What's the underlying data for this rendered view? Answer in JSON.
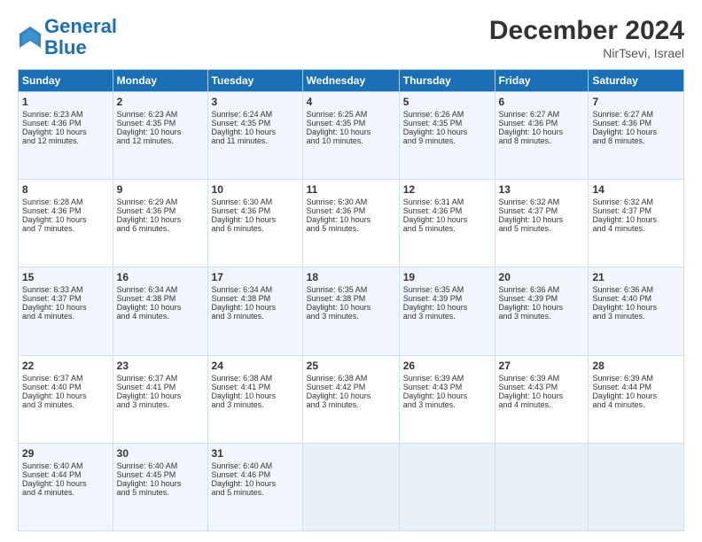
{
  "header": {
    "logo_line1": "General",
    "logo_line2": "Blue",
    "month_title": "December 2024",
    "location": "NirTsevi, Israel"
  },
  "weekdays": [
    "Sunday",
    "Monday",
    "Tuesday",
    "Wednesday",
    "Thursday",
    "Friday",
    "Saturday"
  ],
  "weeks": [
    [
      {
        "num": "1",
        "lines": [
          "Sunrise: 6:23 AM",
          "Sunset: 4:36 PM",
          "Daylight: 10 hours",
          "and 12 minutes."
        ]
      },
      {
        "num": "2",
        "lines": [
          "Sunrise: 6:23 AM",
          "Sunset: 4:35 PM",
          "Daylight: 10 hours",
          "and 12 minutes."
        ]
      },
      {
        "num": "3",
        "lines": [
          "Sunrise: 6:24 AM",
          "Sunset: 4:35 PM",
          "Daylight: 10 hours",
          "and 11 minutes."
        ]
      },
      {
        "num": "4",
        "lines": [
          "Sunrise: 6:25 AM",
          "Sunset: 4:35 PM",
          "Daylight: 10 hours",
          "and 10 minutes."
        ]
      },
      {
        "num": "5",
        "lines": [
          "Sunrise: 6:26 AM",
          "Sunset: 4:35 PM",
          "Daylight: 10 hours",
          "and 9 minutes."
        ]
      },
      {
        "num": "6",
        "lines": [
          "Sunrise: 6:27 AM",
          "Sunset: 4:36 PM",
          "Daylight: 10 hours",
          "and 8 minutes."
        ]
      },
      {
        "num": "7",
        "lines": [
          "Sunrise: 6:27 AM",
          "Sunset: 4:36 PM",
          "Daylight: 10 hours",
          "and 8 minutes."
        ]
      }
    ],
    [
      {
        "num": "8",
        "lines": [
          "Sunrise: 6:28 AM",
          "Sunset: 4:36 PM",
          "Daylight: 10 hours",
          "and 7 minutes."
        ]
      },
      {
        "num": "9",
        "lines": [
          "Sunrise: 6:29 AM",
          "Sunset: 4:36 PM",
          "Daylight: 10 hours",
          "and 6 minutes."
        ]
      },
      {
        "num": "10",
        "lines": [
          "Sunrise: 6:30 AM",
          "Sunset: 4:36 PM",
          "Daylight: 10 hours",
          "and 6 minutes."
        ]
      },
      {
        "num": "11",
        "lines": [
          "Sunrise: 6:30 AM",
          "Sunset: 4:36 PM",
          "Daylight: 10 hours",
          "and 5 minutes."
        ]
      },
      {
        "num": "12",
        "lines": [
          "Sunrise: 6:31 AM",
          "Sunset: 4:36 PM",
          "Daylight: 10 hours",
          "and 5 minutes."
        ]
      },
      {
        "num": "13",
        "lines": [
          "Sunrise: 6:32 AM",
          "Sunset: 4:37 PM",
          "Daylight: 10 hours",
          "and 5 minutes."
        ]
      },
      {
        "num": "14",
        "lines": [
          "Sunrise: 6:32 AM",
          "Sunset: 4:37 PM",
          "Daylight: 10 hours",
          "and 4 minutes."
        ]
      }
    ],
    [
      {
        "num": "15",
        "lines": [
          "Sunrise: 6:33 AM",
          "Sunset: 4:37 PM",
          "Daylight: 10 hours",
          "and 4 minutes."
        ]
      },
      {
        "num": "16",
        "lines": [
          "Sunrise: 6:34 AM",
          "Sunset: 4:38 PM",
          "Daylight: 10 hours",
          "and 4 minutes."
        ]
      },
      {
        "num": "17",
        "lines": [
          "Sunrise: 6:34 AM",
          "Sunset: 4:38 PM",
          "Daylight: 10 hours",
          "and 3 minutes."
        ]
      },
      {
        "num": "18",
        "lines": [
          "Sunrise: 6:35 AM",
          "Sunset: 4:38 PM",
          "Daylight: 10 hours",
          "and 3 minutes."
        ]
      },
      {
        "num": "19",
        "lines": [
          "Sunrise: 6:35 AM",
          "Sunset: 4:39 PM",
          "Daylight: 10 hours",
          "and 3 minutes."
        ]
      },
      {
        "num": "20",
        "lines": [
          "Sunrise: 6:36 AM",
          "Sunset: 4:39 PM",
          "Daylight: 10 hours",
          "and 3 minutes."
        ]
      },
      {
        "num": "21",
        "lines": [
          "Sunrise: 6:36 AM",
          "Sunset: 4:40 PM",
          "Daylight: 10 hours",
          "and 3 minutes."
        ]
      }
    ],
    [
      {
        "num": "22",
        "lines": [
          "Sunrise: 6:37 AM",
          "Sunset: 4:40 PM",
          "Daylight: 10 hours",
          "and 3 minutes."
        ]
      },
      {
        "num": "23",
        "lines": [
          "Sunrise: 6:37 AM",
          "Sunset: 4:41 PM",
          "Daylight: 10 hours",
          "and 3 minutes."
        ]
      },
      {
        "num": "24",
        "lines": [
          "Sunrise: 6:38 AM",
          "Sunset: 4:41 PM",
          "Daylight: 10 hours",
          "and 3 minutes."
        ]
      },
      {
        "num": "25",
        "lines": [
          "Sunrise: 6:38 AM",
          "Sunset: 4:42 PM",
          "Daylight: 10 hours",
          "and 3 minutes."
        ]
      },
      {
        "num": "26",
        "lines": [
          "Sunrise: 6:39 AM",
          "Sunset: 4:43 PM",
          "Daylight: 10 hours",
          "and 3 minutes."
        ]
      },
      {
        "num": "27",
        "lines": [
          "Sunrise: 6:39 AM",
          "Sunset: 4:43 PM",
          "Daylight: 10 hours",
          "and 4 minutes."
        ]
      },
      {
        "num": "28",
        "lines": [
          "Sunrise: 6:39 AM",
          "Sunset: 4:44 PM",
          "Daylight: 10 hours",
          "and 4 minutes."
        ]
      }
    ],
    [
      {
        "num": "29",
        "lines": [
          "Sunrise: 6:40 AM",
          "Sunset: 4:44 PM",
          "Daylight: 10 hours",
          "and 4 minutes."
        ]
      },
      {
        "num": "30",
        "lines": [
          "Sunrise: 6:40 AM",
          "Sunset: 4:45 PM",
          "Daylight: 10 hours",
          "and 5 minutes."
        ]
      },
      {
        "num": "31",
        "lines": [
          "Sunrise: 6:40 AM",
          "Sunset: 4:46 PM",
          "Daylight: 10 hours",
          "and 5 minutes."
        ]
      },
      null,
      null,
      null,
      null
    ]
  ]
}
